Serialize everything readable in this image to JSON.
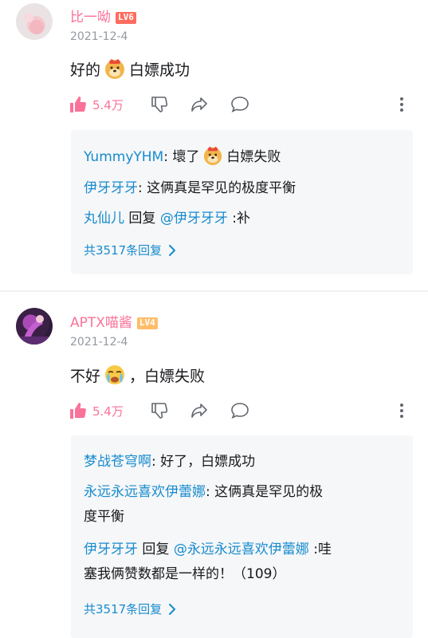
{
  "comments": [
    {
      "username": "比一呦",
      "level": "LV6",
      "date": "2021-12-4",
      "text_before": "好的",
      "emoji": "doge-emoji",
      "text_after": "白嫖成功",
      "likes": "5.4万",
      "replies": [
        {
          "name": "YummyYHM",
          "sep": ": ",
          "text_before": "壞了",
          "emoji": "doge-emoji",
          "text_after": "白嫖失败"
        },
        {
          "name": "伊牙牙牙",
          "sep": ": ",
          "text": "这俩真是罕见的极度平衡"
        },
        {
          "name": "丸仙儿",
          "reply_word": " 回复 ",
          "mention": "@伊牙牙牙",
          "text": " :补"
        }
      ],
      "more_label": "共3517条回复"
    },
    {
      "username": "APTX喵酱",
      "level": "LV4",
      "date": "2021-12-4",
      "text_before": "不好",
      "emoji": "crying-emoji",
      "text_after": "，白嫖失败",
      "likes": "5.4万",
      "replies": [
        {
          "name": "梦战苍穹啊",
          "sep": ": ",
          "text": "好了，白嫖成功"
        },
        {
          "name": "永远永远喜欢伊蕾娜",
          "sep": ": ",
          "text_line1": "这俩真是罕见的极",
          "text_line2": "度平衡"
        },
        {
          "name": "伊牙牙牙",
          "reply_word": " 回复 ",
          "mention": "@永远永远喜欢伊蕾娜",
          "text_line1": " :哇",
          "text_line2": "塞我俩赞数都是一样的！（109）"
        }
      ],
      "more_label": "共3517条回复"
    }
  ],
  "colors": {
    "pink": "#fb7299",
    "blue": "#178bcf",
    "gray": "#9499a0",
    "reply_bg": "#f6f7f8"
  }
}
